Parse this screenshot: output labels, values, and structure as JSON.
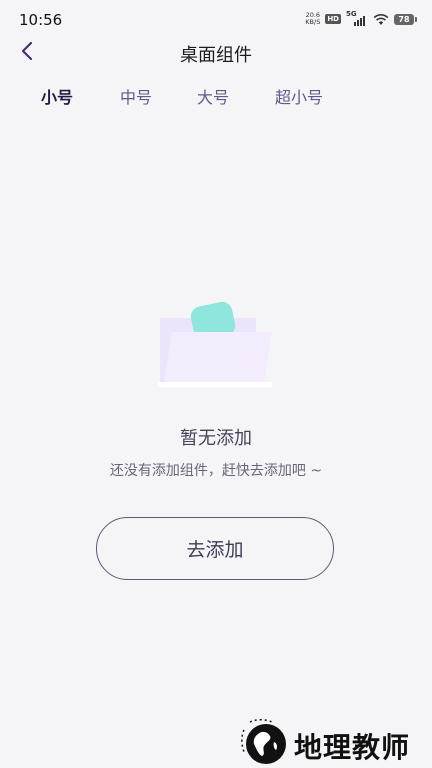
{
  "status_bar": {
    "time": "10:56",
    "net_speed_value": "20.6",
    "net_speed_unit": "KB/S",
    "hd_badge": "HD",
    "network_type": "5G",
    "battery_level": "78"
  },
  "header": {
    "title": "桌面组件",
    "back_icon": "chevron-left-icon",
    "accent_color": "#4a2c7a"
  },
  "tabs": [
    {
      "label": "小号",
      "active": true
    },
    {
      "label": "中号",
      "active": false
    },
    {
      "label": "大号",
      "active": false
    },
    {
      "label": "超小号",
      "active": false
    }
  ],
  "empty_state": {
    "illustration_icon": "empty-folder-icon",
    "title": "暂无添加",
    "description": "还没有添加组件，赶快去添加吧 ~"
  },
  "add_button": {
    "label": "去添加"
  },
  "watermark": {
    "text": "地理教师"
  }
}
